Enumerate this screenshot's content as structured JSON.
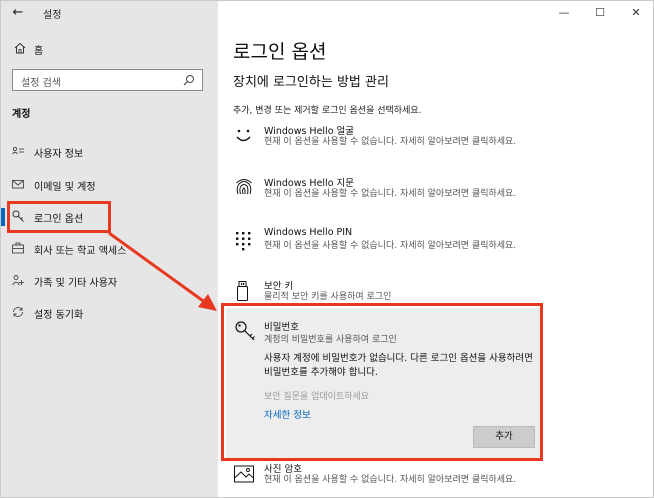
{
  "window": {
    "app_title": "설정",
    "back_glyph": "←",
    "minimize_glyph": "—",
    "maximize_glyph": "☐",
    "close_glyph": "✕"
  },
  "sidebar": {
    "home_label": "홈",
    "search_placeholder": "설정 검색",
    "section_heading": "계정",
    "items": [
      {
        "label": "사용자 정보",
        "icon": "user-info-icon"
      },
      {
        "label": "이메일 및 계정",
        "icon": "mail-icon"
      },
      {
        "label": "로그인 옵션",
        "icon": "key-icon",
        "active": true
      },
      {
        "label": "회사 또는 학교 액세스",
        "icon": "briefcase-icon"
      },
      {
        "label": "가족 및 기타 사용자",
        "icon": "people-icon"
      },
      {
        "label": "설정 동기화",
        "icon": "sync-icon"
      }
    ]
  },
  "main": {
    "title": "로그인 옵션",
    "subtitle": "장치에 로그인하는 방법 관리",
    "description": "추가, 변경 또는 제거할 로그인 옵션을 선택하세요.",
    "options": [
      {
        "title": "Windows Hello 얼굴",
        "desc": "현재 이 옵션을 사용할 수 없습니다. 자세히 알아보려면 클릭하세요.",
        "icon": "face-smile-icon"
      },
      {
        "title": "Windows Hello 지문",
        "desc": "현재 이 옵션을 사용할 수 없습니다. 자세히 알아보려면 클릭하세요.",
        "icon": "fingerprint-icon"
      },
      {
        "title": "Windows Hello PIN",
        "desc": "현재 이 옵션을 사용할 수 없습니다. 자세히 알아보려면 클릭하세요.",
        "icon": "pin-keypad-icon"
      },
      {
        "title": "보안 키",
        "desc": "물리적 보안 키를 사용하여 로그인",
        "icon": "usb-key-icon"
      }
    ],
    "password": {
      "title": "비밀번호",
      "subtitle": "계정의 비밀번호를 사용하여 로그인",
      "message": "사용자 계정에 비밀번호가 없습니다. 다른 로그인 옵션을 사용하려면 비밀번호를 추가해야 합니다.",
      "security_questions": "보안 질문을 업데이트하세요",
      "learn_more": "자세한 정보",
      "add_button": "추가"
    },
    "picture_password": {
      "title": "사진 암호",
      "desc": "현재 이 옵션을 사용할 수 없습니다. 자세히 알아보려면 클릭하세요."
    }
  },
  "colors": {
    "highlight": "#e8381f",
    "accent": "#0067c0",
    "sidebar_bg": "#e6e6e6",
    "panel_bg": "#ededed"
  }
}
